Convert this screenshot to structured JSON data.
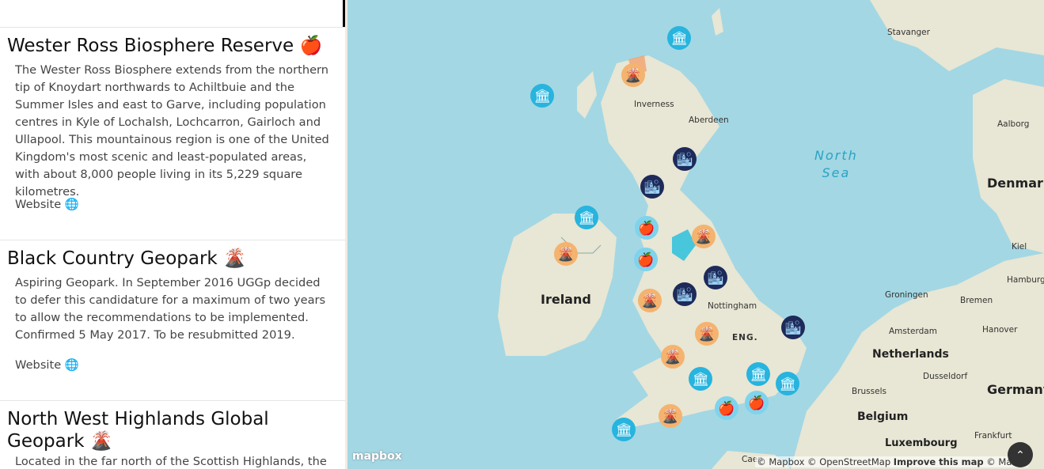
{
  "sidebar": {
    "cards": [
      {
        "title": "Wester Ross Biosphere Reserve",
        "emoji": "🍎",
        "description": "The Wester Ross Biosphere extends from the northern tip of Knoydart northwards to Achiltbuie and the Summer Isles and east to Garve, including population centres in Kyle of Lochalsh, Lochcarron, Gairloch and Ullapool. This mountainous region is one of the United Kingdom's most scenic and least-populated areas, with about 8,000 people living in its 5,229 square kilometres.",
        "link": "Website 🌐"
      },
      {
        "title": "Black Country Geopark",
        "emoji": "🌋",
        "description": "Aspiring Geopark. In September 2016 UGGp decided to defer this candidature for a maximum of two years to allow the recommendations to be implemented. Confirmed 5 May 2017. To be resubmitted 2019.",
        "link": "Website 🌐"
      },
      {
        "title": "North West Highlands Global Geopark",
        "emoji": "🌋",
        "description": "Located in the far north of the Scottish Highlands, the",
        "link": ""
      }
    ]
  },
  "map": {
    "labels": {
      "stavanger": "Stavanger",
      "inverness": "Inverness",
      "aberdeen": "Aberdeen",
      "aalborg": "Aalborg",
      "denmark": "Denmark",
      "kiel": "Kiel",
      "hamburg": "Hamburg",
      "groningen": "Groningen",
      "bremen": "Bremen",
      "amsterdam": "Amsterdam",
      "hanover": "Hanover",
      "netherlands": "Netherlands",
      "dusseldorf": "Dusseldorf",
      "brussels": "Brussels",
      "belgium": "Belgium",
      "germany": "Germany",
      "luxembourg": "Luxembourg",
      "frankfurt": "Frankfurt",
      "caen": "Caen",
      "ireland": "Ireland",
      "nottingham": "Nottingham",
      "eng": "ENG.",
      "north": "North",
      "sea": "Sea"
    },
    "logo": "mapbox",
    "attribution_1": "© Mapbox © OpenStreetMap",
    "attribution_2": "Improve this map",
    "attribution_3": "© Maxar",
    "marker_icons": {
      "museum": "museum-icon",
      "city": "city-icon",
      "biosphere": "apple-icon",
      "geopark": "volcano-icon"
    }
  },
  "colors": {
    "water": "#a3d7e4",
    "land": "#e8e6d4",
    "museum": "#27b4de",
    "city": "#1d2a5a"
  }
}
